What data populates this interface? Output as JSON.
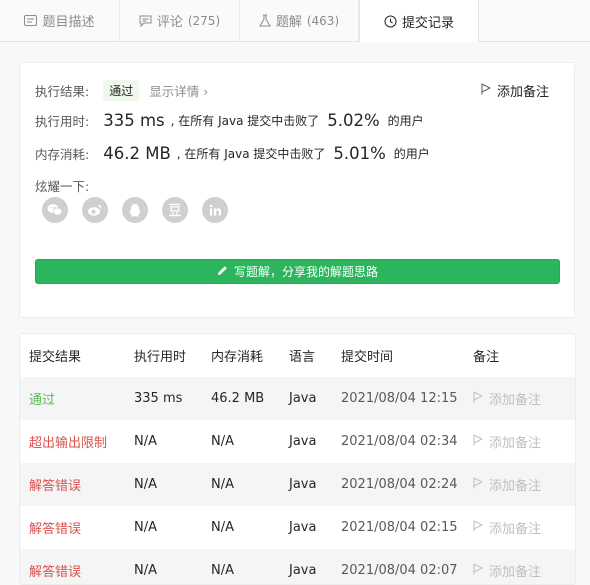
{
  "tabs": [
    {
      "label": "题目描述",
      "count": "",
      "icon": "description-icon"
    },
    {
      "label": "评论",
      "count": "(275)",
      "icon": "comment-icon"
    },
    {
      "label": "题解",
      "count": "(463)",
      "icon": "flask-icon"
    },
    {
      "label": "提交记录",
      "count": "",
      "icon": "clock-icon"
    }
  ],
  "result": {
    "status_label": "执行结果:",
    "status_value": "通过",
    "detail_link": "显示详情",
    "add_note": "添加备注",
    "runtime_label": "执行用时:",
    "runtime_value": "335 ms",
    "runtime_mid": ", 在所有 Java 提交中击败了",
    "runtime_pct": "5.02%",
    "runtime_suffix": "的用户",
    "memory_label": "内存消耗:",
    "memory_value": "46.2 MB",
    "memory_mid": ", 在所有 Java 提交中击败了",
    "memory_pct": "5.01%",
    "memory_suffix": "的用户",
    "share_label": "炫耀一下:",
    "share_icons": [
      "wechat-icon",
      "weibo-icon",
      "qq-icon",
      "douban-icon",
      "linkedin-icon"
    ],
    "write_button": "写题解，分享我的解题思路"
  },
  "table": {
    "headers": [
      "提交结果",
      "执行用时",
      "内存消耗",
      "语言",
      "提交时间",
      "备注"
    ],
    "rows": [
      {
        "status": "通过",
        "runtime": "335 ms",
        "memory": "46.2 MB",
        "lang": "Java",
        "time": "2021/08/04 12:15",
        "note": "添加备注"
      },
      {
        "status": "超出输出限制",
        "runtime": "N/A",
        "memory": "N/A",
        "lang": "Java",
        "time": "2021/08/04 02:34",
        "note": "添加备注"
      },
      {
        "status": "解答错误",
        "runtime": "N/A",
        "memory": "N/A",
        "lang": "Java",
        "time": "2021/08/04 02:24",
        "note": "添加备注"
      },
      {
        "status": "解答错误",
        "runtime": "N/A",
        "memory": "N/A",
        "lang": "Java",
        "time": "2021/08/04 02:15",
        "note": "添加备注"
      },
      {
        "status": "解答错误",
        "runtime": "N/A",
        "memory": "N/A",
        "lang": "Java",
        "time": "2021/08/04 02:07",
        "note": "添加备注"
      }
    ]
  },
  "colors": {
    "accent_green": "#2db55d",
    "pass": "#5cb85c",
    "fail": "#d9534f"
  }
}
